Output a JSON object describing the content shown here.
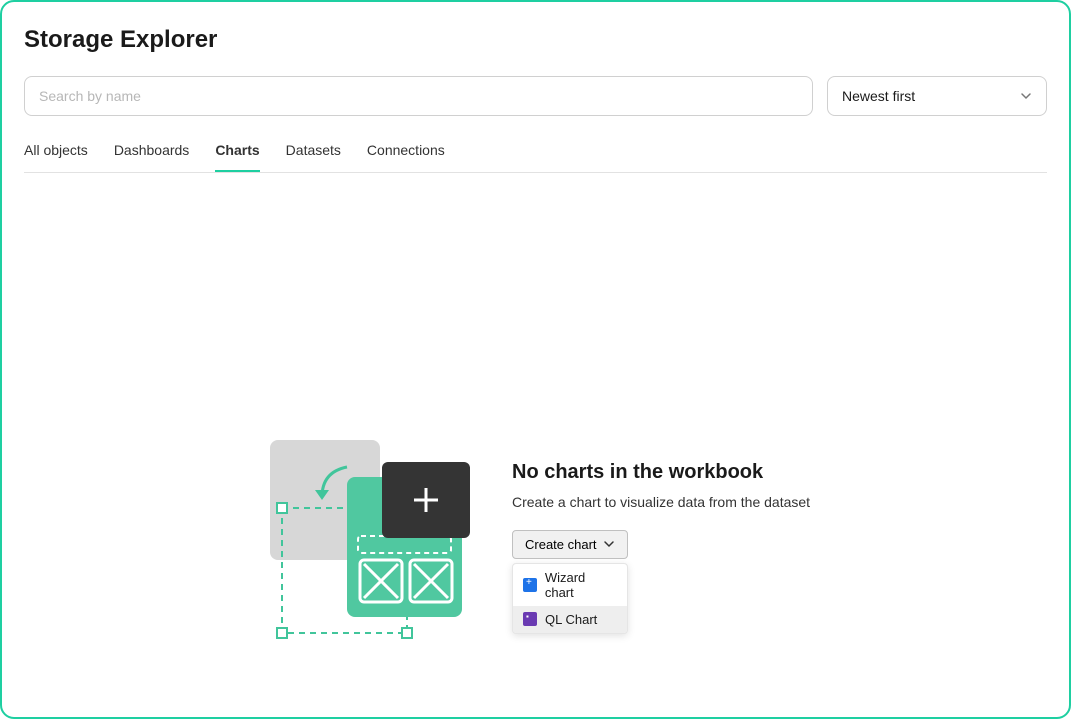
{
  "title": "Storage Explorer",
  "search": {
    "placeholder": "Search by name",
    "value": ""
  },
  "sort": {
    "selected": "Newest first"
  },
  "tabs": [
    {
      "label": "All objects",
      "active": false
    },
    {
      "label": "Dashboards",
      "active": false
    },
    {
      "label": "Charts",
      "active": true
    },
    {
      "label": "Datasets",
      "active": false
    },
    {
      "label": "Connections",
      "active": false
    }
  ],
  "empty": {
    "heading": "No charts in the workbook",
    "subtext": "Create a chart to visualize data from the dataset",
    "button": "Create chart",
    "menu": [
      {
        "label": "Wizard chart",
        "icon": "wizard"
      },
      {
        "label": "QL Chart",
        "icon": "ql"
      }
    ]
  }
}
